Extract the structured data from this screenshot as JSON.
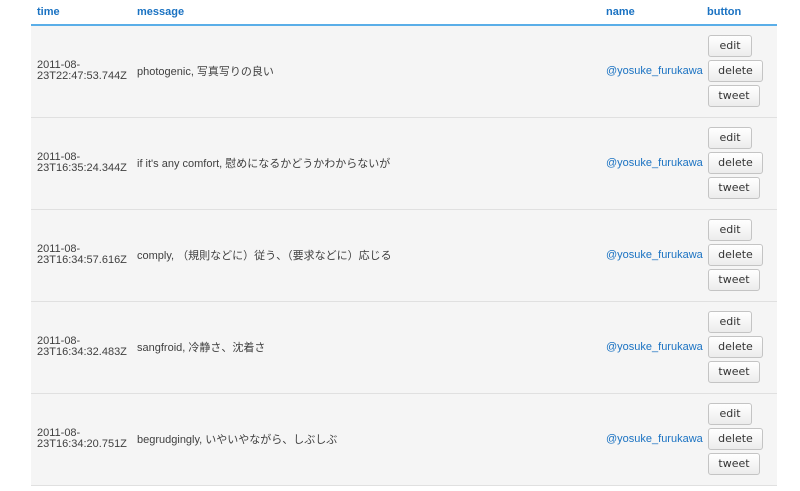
{
  "columns": {
    "time": "time",
    "message": "message",
    "name": "name",
    "button": "button"
  },
  "rows": [
    {
      "time_line1": "2011-08-",
      "time_line2": "23T22:47:53.744Z",
      "message": "photogenic, 写真写りの良い",
      "name": "@yosuke_furukawa",
      "edit": "edit",
      "delete": "delete",
      "tweet": "tweet"
    },
    {
      "time_line1": "2011-08-",
      "time_line2": "23T16:35:24.344Z",
      "message": "if it's any comfort, 慰めになるかどうかわからないが",
      "name": "@yosuke_furukawa",
      "edit": "edit",
      "delete": "delete",
      "tweet": "tweet"
    },
    {
      "time_line1": "2011-08-",
      "time_line2": "23T16:34:57.616Z",
      "message": "comply, （規則などに）従う、（要求などに）応じる",
      "name": "@yosuke_furukawa",
      "edit": "edit",
      "delete": "delete",
      "tweet": "tweet"
    },
    {
      "time_line1": "2011-08-",
      "time_line2": "23T16:34:32.483Z",
      "message": "sangfroid, 冷静さ、沈着さ",
      "name": "@yosuke_furukawa",
      "edit": "edit",
      "delete": "delete",
      "tweet": "tweet"
    },
    {
      "time_line1": "2011-08-",
      "time_line2": "23T16:34:20.751Z",
      "message": "begrudgingly, いやいやながら、しぶしぶ",
      "name": "@yosuke_furukawa",
      "edit": "edit",
      "delete": "delete",
      "tweet": "tweet"
    }
  ],
  "colors": {
    "header_text": "#1a72c2",
    "header_rule": "#5aaee8",
    "row_bg": "#f5f5f5",
    "link": "#1a72c2"
  }
}
